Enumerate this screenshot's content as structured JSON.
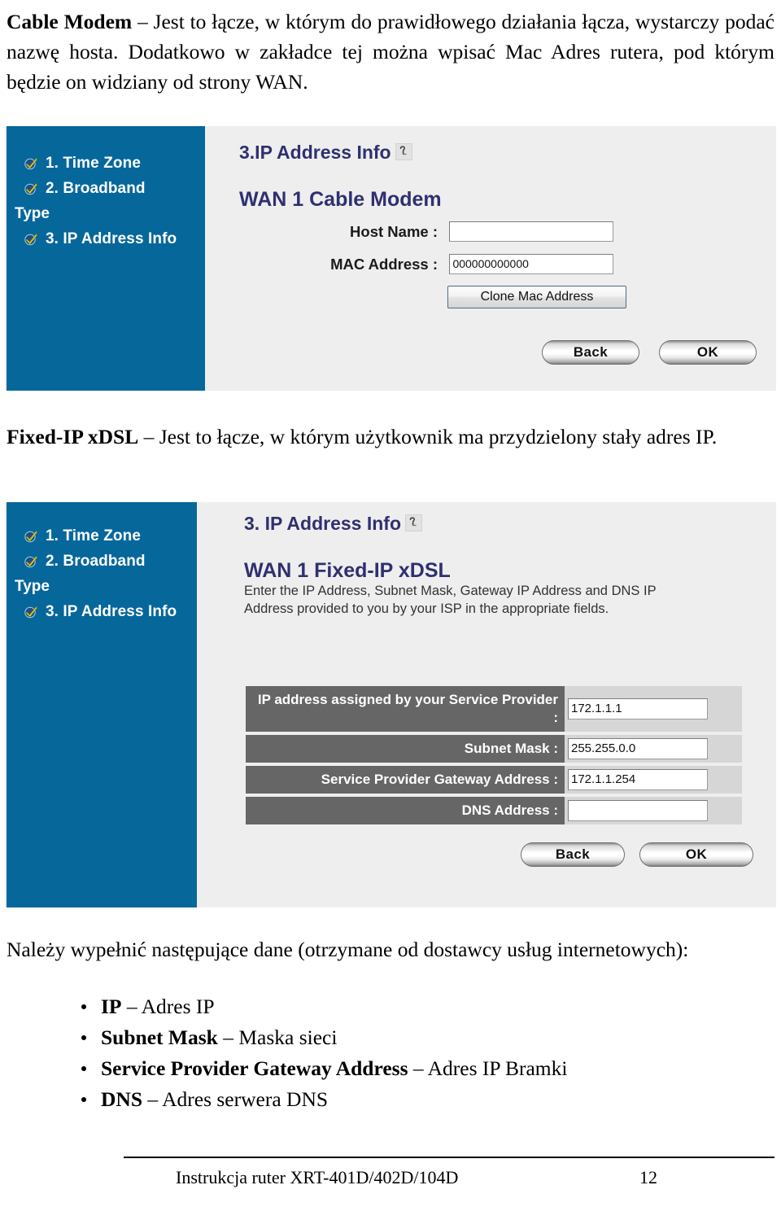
{
  "document": {
    "intro_paragraph": {
      "term": "Cable Modem",
      "dash": " – ",
      "text": "Jest to łącze, w którym do prawidłowego działania łącza, wystarczy podać nazwę hosta. Dodatkowo w zakładce tej można wpisać Mac Adres rutera, pod którym będzie on widziany od strony WAN."
    },
    "fixed_paragraph": {
      "term": "Fixed-IP xDSL",
      "dash": " – ",
      "text": "Jest to łącze, w którym użytkownik ma przydzielony stały adres IP."
    },
    "fill_paragraph": {
      "text": "Należy wypełnić następujące dane (otrzymane od dostawcy usług internetowych):"
    },
    "bullets": [
      {
        "term": "IP",
        "dash": " – ",
        "text": "Adres IP"
      },
      {
        "term": "Subnet Mask",
        "dash": " – ",
        "text": "Maska sieci"
      },
      {
        "term": "Service Provider Gateway Address",
        "dash": " – ",
        "text": "Adres IP Bramki"
      },
      {
        "term": "DNS",
        "dash": " – ",
        "text": "Adres serwera DNS"
      }
    ],
    "footer": {
      "title": "Instrukcja ruter XRT-401D/402D/104D",
      "page_number": "12"
    }
  },
  "screenshot_cable_modem": {
    "sidebar": {
      "items": [
        {
          "label": "1. Time Zone",
          "icon": "check-icon",
          "checked": true
        },
        {
          "label": "2. Broadband",
          "continuation": "Type",
          "icon": "check-icon",
          "checked": true
        },
        {
          "label": "3. IP Address Info",
          "icon": "check-icon",
          "checked": true
        }
      ]
    },
    "section_title": "3.IP Address Info",
    "help_icon": "help-icon",
    "wan_title": "WAN 1 Cable Modem",
    "fields": [
      {
        "label": "Host Name :",
        "value": ""
      },
      {
        "label": "MAC Address :",
        "value": "000000000000"
      }
    ],
    "clone_button": "Clone Mac Address",
    "back_button": "Back",
    "ok_button": "OK"
  },
  "screenshot_fixed_ip": {
    "sidebar": {
      "items": [
        {
          "label": "1. Time Zone",
          "icon": "check-icon",
          "checked": true
        },
        {
          "label": "2. Broadband",
          "continuation": "Type",
          "icon": "check-icon",
          "checked": true
        },
        {
          "label": "3. IP Address Info",
          "icon": "check-icon",
          "checked": true
        }
      ]
    },
    "section_title": "3. IP Address Info",
    "help_icon": "help-icon",
    "wan_title": "WAN 1 Fixed-IP xDSL",
    "wan_description": "Enter the IP Address, Subnet Mask, Gateway IP Address and DNS IP Address provided to you by your ISP in the appropriate fields.",
    "form_rows": [
      {
        "label": "IP address assigned by your Service Provider :",
        "value": "172.1.1.1"
      },
      {
        "label": "Subnet Mask :",
        "value": "255.255.0.0"
      },
      {
        "label": "Service Provider Gateway Address :",
        "value": "172.1.1.254"
      },
      {
        "label": "DNS Address :",
        "value": ""
      }
    ],
    "back_button": "Back",
    "ok_button": "OK"
  },
  "colors": {
    "sidebar_blue": "#06679b",
    "panel_gray": "#eeeeee",
    "heading_navy": "#2f3070",
    "form_label_gray": "#666666",
    "form_row_gray": "#d6d6d6",
    "check_yellow": "#f2e13c"
  }
}
